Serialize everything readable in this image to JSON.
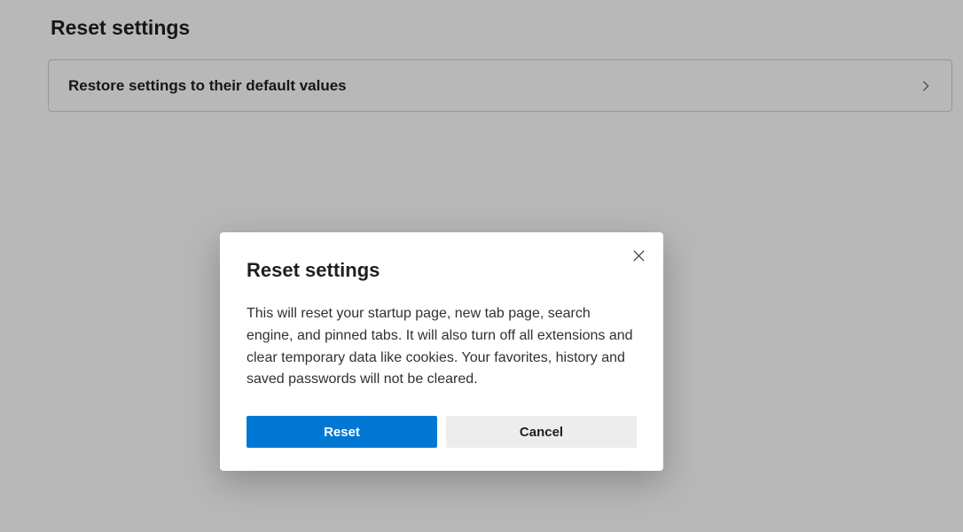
{
  "section": {
    "title": "Reset settings",
    "row_label": "Restore settings to their default values"
  },
  "dialog": {
    "title": "Reset settings",
    "body": "This will reset your startup page, new tab page, search engine, and pinned tabs. It will also turn off all extensions and clear temporary data like cookies. Your favorites, history and saved passwords will not be cleared.",
    "primary_label": "Reset",
    "secondary_label": "Cancel"
  }
}
